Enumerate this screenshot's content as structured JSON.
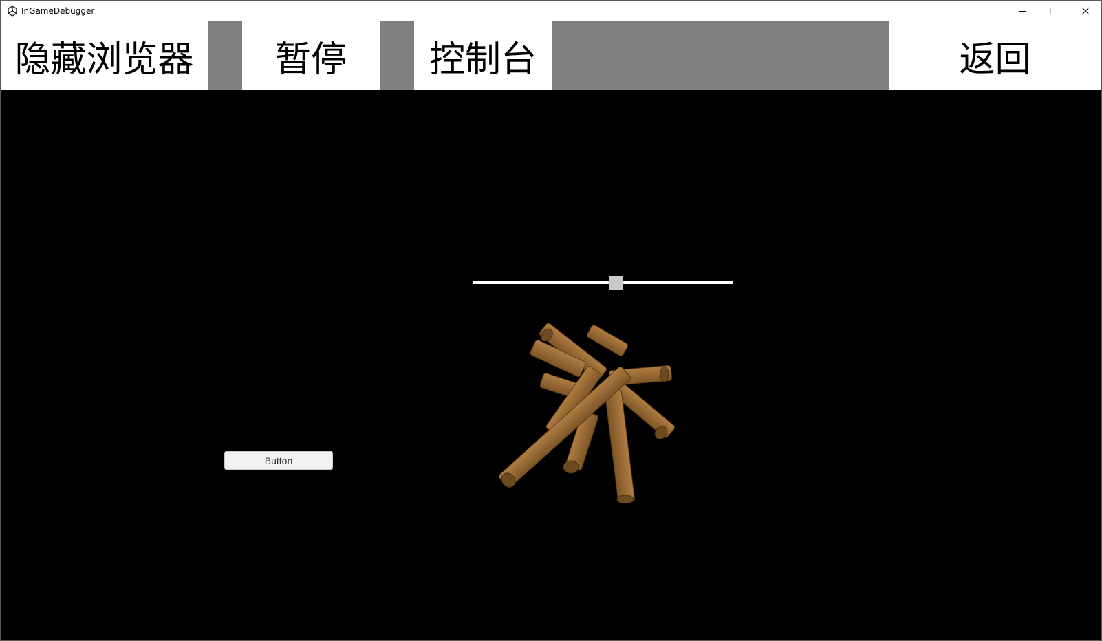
{
  "window": {
    "title": "InGameDebugger",
    "icon": "unity-logo-icon",
    "controls": [
      "minimize-icon",
      "maximize-icon",
      "close-icon"
    ]
  },
  "toolbar": {
    "hide_browser": "隐藏浏览器",
    "pause": "暂停",
    "console": "控制台",
    "back": "返回"
  },
  "game": {
    "slider_value": 0.55,
    "button_label": "Button",
    "scene_object": "log-pile",
    "colors": {
      "background": "#000000",
      "log": "#9a6b34",
      "toolbar_gap": "#808080"
    }
  }
}
